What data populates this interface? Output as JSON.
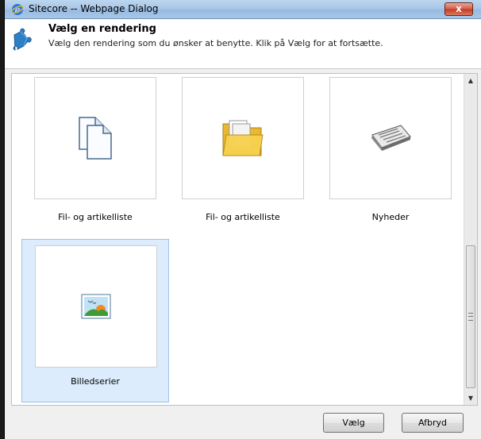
{
  "window": {
    "title": "Sitecore -- Webpage Dialog",
    "close_label": "x"
  },
  "header": {
    "title": "Vælg en rendering",
    "subtitle": "Vælg den rendering som du ønsker at benytte. Klik på Vælg for at fortsætte."
  },
  "renderings": [
    {
      "label": "Fil- og artikelliste",
      "icon": "documents-icon",
      "selected": false
    },
    {
      "label": "Fil- og artikelliste",
      "icon": "folder-icon",
      "selected": false
    },
    {
      "label": "Nyheder",
      "icon": "newspaper-icon",
      "selected": false
    },
    {
      "label": "Billedserier",
      "icon": "picture-icon",
      "selected": true
    }
  ],
  "buttons": {
    "select_label": "Vælg",
    "cancel_label": "Afbryd"
  }
}
